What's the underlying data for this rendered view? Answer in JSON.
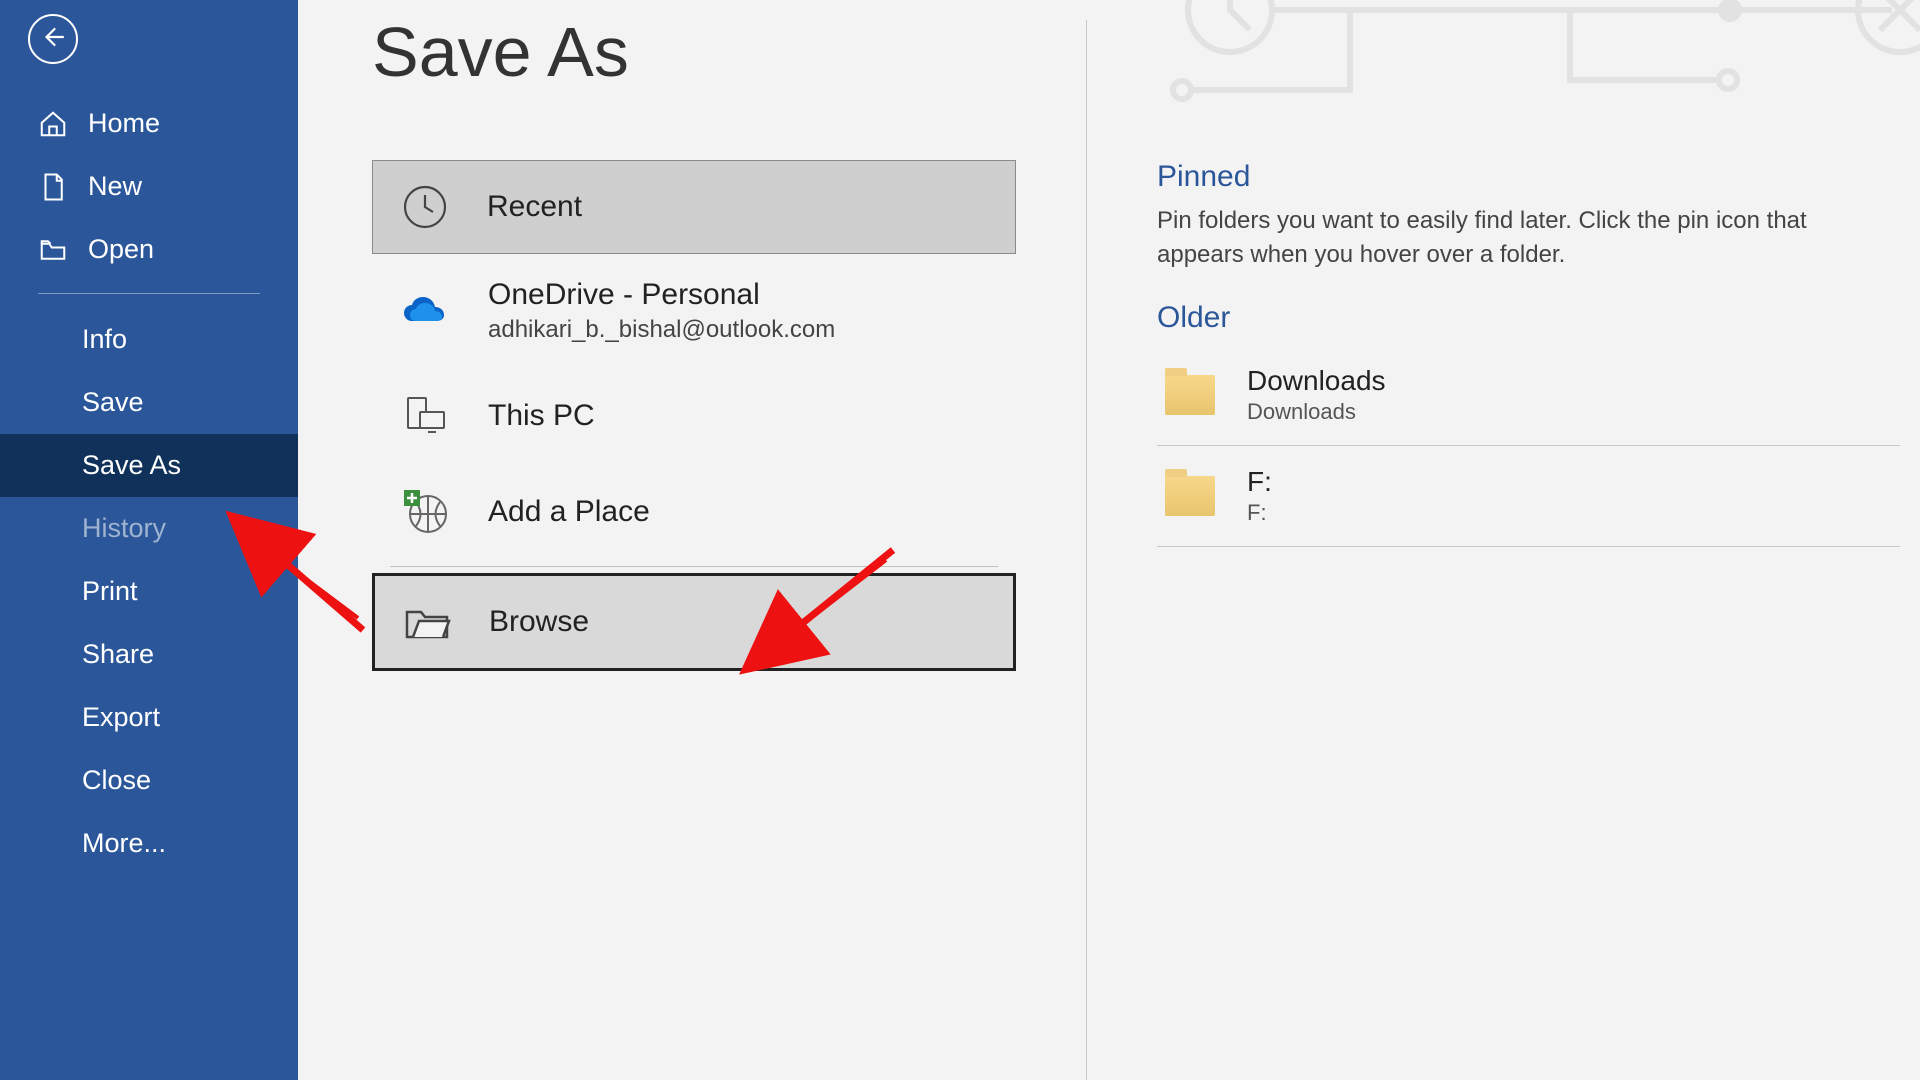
{
  "page": {
    "title": "Save As"
  },
  "sidebar": {
    "items": [
      {
        "label": "Home"
      },
      {
        "label": "New"
      },
      {
        "label": "Open"
      },
      {
        "label": "Info"
      },
      {
        "label": "Save"
      },
      {
        "label": "Save As"
      },
      {
        "label": "History"
      },
      {
        "label": "Print"
      },
      {
        "label": "Share"
      },
      {
        "label": "Export"
      },
      {
        "label": "Close"
      },
      {
        "label": "More..."
      }
    ]
  },
  "locations": {
    "recent": "Recent",
    "onedrive": {
      "title": "OneDrive - Personal",
      "subtitle": "adhikari_b._bishal@outlook.com"
    },
    "thispc": "This PC",
    "addplace": "Add a Place",
    "browse": "Browse"
  },
  "right": {
    "pinned": {
      "heading": "Pinned",
      "hint": "Pin folders you want to easily find later. Click the pin icon that appears when you hover over a folder."
    },
    "older": {
      "heading": "Older",
      "folders": [
        {
          "name": "Downloads",
          "path": "Downloads"
        },
        {
          "name": "F:",
          "path": "F:"
        }
      ]
    }
  }
}
